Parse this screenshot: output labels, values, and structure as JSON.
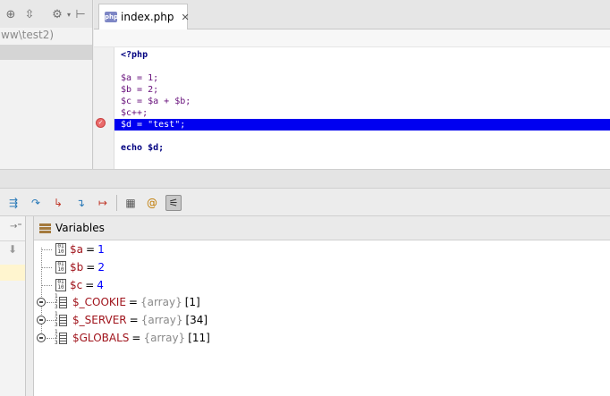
{
  "project": {
    "path_fragment": "ww\\test2)"
  },
  "editor": {
    "tab_label": "index.php",
    "tab_close": "✕",
    "file_icon_text": "php",
    "lines": [
      {
        "text": "<?php"
      },
      {
        "text": ""
      },
      {
        "text": "$a = 1;"
      },
      {
        "text": "$b = 2;"
      },
      {
        "text": "$c = $a + $b;"
      },
      {
        "text": "$c++;"
      },
      {
        "text": "$d = \"test\";"
      },
      {
        "text": ""
      },
      {
        "text": "echo $d;"
      }
    ]
  },
  "variables_panel": {
    "title": "Variables",
    "items": [
      {
        "name": "$a",
        "eq": "=",
        "value": "1",
        "kind": "scalar"
      },
      {
        "name": "$b",
        "eq": "=",
        "value": "2",
        "kind": "scalar"
      },
      {
        "name": "$c",
        "eq": "=",
        "value": "4",
        "kind": "scalar"
      },
      {
        "name": "$_COOKIE",
        "eq": "=",
        "type": "{array}",
        "count": "[1]",
        "kind": "array"
      },
      {
        "name": "$_SERVER",
        "eq": "=",
        "type": "{array}",
        "count": "[34]",
        "kind": "array"
      },
      {
        "name": "$GLOBALS",
        "eq": "=",
        "type": "{array}",
        "count": "[11]",
        "kind": "array"
      }
    ],
    "scalar_icon_text": "01\n10"
  },
  "icons": {
    "project_toolbar": [
      "crosshair-icon",
      "collapse-icon",
      "gear-icon",
      "hide-icon"
    ],
    "debug_toolbar": [
      "show-execution-point-icon",
      "step-over-icon",
      "step-into-icon",
      "force-step-into-icon",
      "step-out-icon",
      "run-to-cursor-icon",
      "evaluate-expression-icon",
      "watch-icon",
      "settings-icon"
    ],
    "frames": [
      "restore-layout-icon",
      "down-arrow-icon"
    ]
  },
  "colors": {
    "highlight_line": "#0000f0",
    "var_name": "#a0141c",
    "number_value": "#0000ff",
    "type_text": "#8a8a8a"
  }
}
